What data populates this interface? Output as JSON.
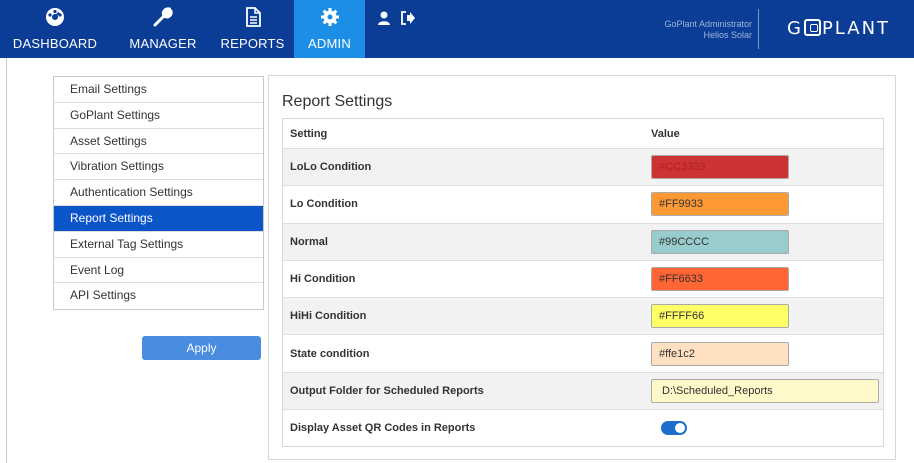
{
  "nav": {
    "items": [
      {
        "label": "DASHBOARD",
        "icon": "dashboard-gauge-icon"
      },
      {
        "label": "MANAGER",
        "icon": "wrench-icon"
      },
      {
        "label": "REPORTS",
        "icon": "document-icon"
      },
      {
        "label": "ADMIN",
        "icon": "gear-icon",
        "active": true
      }
    ],
    "user_icon": "user-icon",
    "logout_icon": "logout-icon"
  },
  "user": {
    "role": "GoPlant Administrator",
    "org": "Helios Solar"
  },
  "logo": {
    "prefix": "G",
    "suffix": "PLANT"
  },
  "sidebar": {
    "items": [
      {
        "label": "Email Settings"
      },
      {
        "label": "GoPlant Settings"
      },
      {
        "label": "Asset Settings"
      },
      {
        "label": "Vibration Settings"
      },
      {
        "label": "Authentication Settings"
      },
      {
        "label": "Report Settings",
        "active": true
      },
      {
        "label": "External Tag Settings"
      },
      {
        "label": "Event Log"
      },
      {
        "label": "API Settings"
      }
    ],
    "apply_label": "Apply"
  },
  "panel": {
    "title": "Report Settings",
    "columns": {
      "setting": "Setting",
      "value": "Value"
    },
    "rows": [
      {
        "label": "LoLo Condition",
        "value": "#CC3333",
        "color": "#cc3333",
        "text_color": "#b12020"
      },
      {
        "label": "Lo Condition",
        "value": "#FF9933",
        "color": "#ff9933",
        "text_color": "#333333"
      },
      {
        "label": "Normal",
        "value": "#99CCCC",
        "color": "#99cccc",
        "text_color": "#333333"
      },
      {
        "label": "Hi Condition",
        "value": "#FF6633",
        "color": "#ff6633",
        "text_color": "#333333"
      },
      {
        "label": "HiHi Condition",
        "value": "#FFFF66",
        "color": "#ffff66",
        "text_color": "#333333"
      },
      {
        "label": "State condition",
        "value": "#ffe1c2",
        "color": "#ffe1c2",
        "text_color": "#333333"
      },
      {
        "label": "Output Folder for Scheduled Reports",
        "value": "D:\\Scheduled_Reports"
      },
      {
        "label": "Display Asset QR Codes in Reports",
        "toggle_on": true
      }
    ]
  },
  "colors": {
    "topbar": "#0b3d96",
    "nav_active": "#1d8ee6",
    "sidebar_active": "#0b55c9",
    "apply_button": "#4a8ce0",
    "toggle_on": "#1d6fce"
  }
}
